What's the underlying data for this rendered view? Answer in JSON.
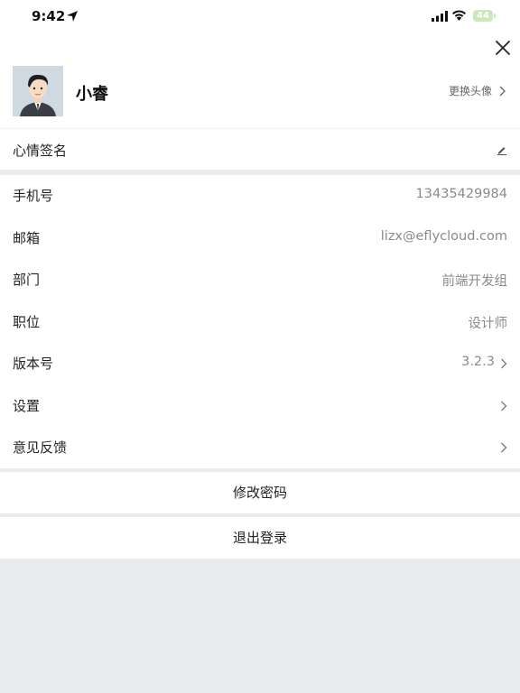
{
  "status_bar": {
    "time": "9:42",
    "battery": "44"
  },
  "profile": {
    "name": "小睿",
    "change_avatar_label": "更换头像"
  },
  "mood": {
    "label": "心情签名"
  },
  "info": [
    {
      "label": "手机号",
      "value": "13435429984"
    },
    {
      "label": "邮箱",
      "value": "lizx@eflycloud.com"
    },
    {
      "label": "部门",
      "value": "前端开发组"
    },
    {
      "label": "职位",
      "value": "设计师"
    },
    {
      "label": "版本号",
      "value": "3.2.3"
    },
    {
      "label": "设置",
      "value": ""
    },
    {
      "label": "意见反馈",
      "value": ""
    }
  ],
  "actions": {
    "change_password": "修改密码",
    "logout": "退出登录"
  },
  "icons": {
    "close": "close-icon",
    "edit": "pencil-icon",
    "chevron": "chevron-right-icon",
    "location": "location-arrow-icon",
    "signal": "signal-icon",
    "wifi": "wifi-icon",
    "battery": "battery-icon"
  }
}
